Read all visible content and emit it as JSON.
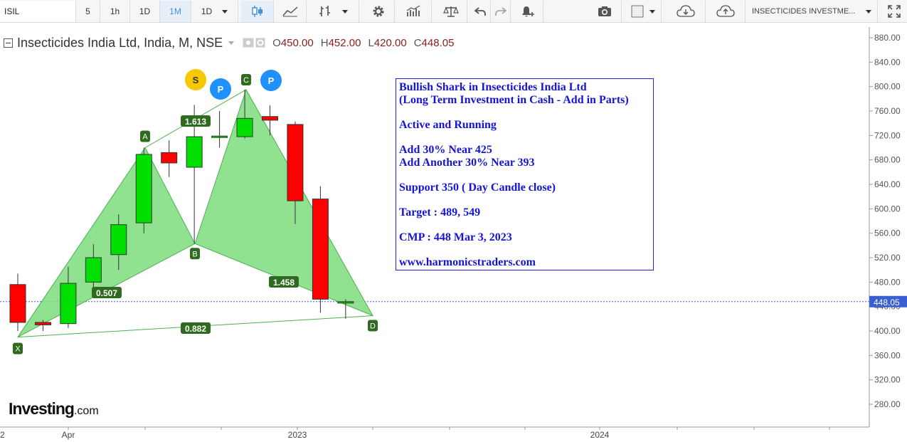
{
  "toolbar": {
    "symbol": "ISIL",
    "intervals": [
      "5",
      "1h",
      "1D",
      "1M",
      "1D"
    ],
    "active_interval": "1M",
    "instrument": "INSECTICIDES INVESTME..."
  },
  "header": {
    "title": "Insecticides India Ltd, India, M, NSE",
    "open_label": "O",
    "open": "450.00",
    "high_label": "H",
    "high": "452.00",
    "low_label": "L",
    "low": "420.00",
    "close_label": "C",
    "close": "448.05"
  },
  "annotation": {
    "line1": "Bullish Shark in Insecticides India Ltd",
    "line2": "(Long Term Investment in Cash - Add in Parts)",
    "line3": "Active and Running",
    "line4": "Add 30% Near 425",
    "line5": "Add Another 30% Near 393",
    "line6": "Support 350 ( Day Candle close)",
    "line7": "Target : 489, 549",
    "line8": "CMP : 448 Mar 3, 2023",
    "line9": "www.harmonicstraders.com"
  },
  "logo": {
    "main": "Investing",
    "suffix": ".com"
  },
  "colors": {
    "up": "#00e000",
    "down": "#ff0000",
    "pattern_fill": "#7ddc7d",
    "price_line": "#3a5fd0",
    "label_bg": "#2e6b1f"
  },
  "chart_data": {
    "type": "candlestick",
    "candles": [
      {
        "o": 476,
        "h": 494,
        "l": 400,
        "c": 414
      },
      {
        "o": 414,
        "h": 418,
        "l": 400,
        "c": 410
      },
      {
        "o": 412,
        "h": 505,
        "l": 405,
        "c": 478
      },
      {
        "o": 480,
        "h": 542,
        "l": 465,
        "c": 520
      },
      {
        "o": 525,
        "h": 591,
        "l": 500,
        "c": 574
      },
      {
        "o": 577,
        "h": 700,
        "l": 560,
        "c": 689
      },
      {
        "o": 692,
        "h": 712,
        "l": 652,
        "c": 675
      },
      {
        "o": 668,
        "h": 770,
        "l": 543,
        "c": 718
      },
      {
        "o": 718,
        "h": 760,
        "l": 700,
        "c": 719
      },
      {
        "o": 718,
        "h": 795,
        "l": 715,
        "c": 748
      },
      {
        "o": 751,
        "h": 769,
        "l": 720,
        "c": 745
      },
      {
        "o": 738,
        "h": 743,
        "l": 575,
        "c": 613
      },
      {
        "o": 616,
        "h": 637,
        "l": 430,
        "c": 452
      },
      {
        "o": 448,
        "h": 452,
        "l": 420,
        "c": 448
      }
    ],
    "pattern": {
      "points": [
        {
          "label": "X",
          "price": 390
        },
        {
          "label": "A",
          "price": 700
        },
        {
          "label": "B",
          "price": 543
        },
        {
          "label": "C",
          "price": 795
        },
        {
          "label": "D",
          "price": 425
        }
      ],
      "ratios": [
        "0.507",
        "1.613",
        "1.458",
        "0.882"
      ]
    },
    "markers": [
      "S",
      "P",
      "P"
    ],
    "y_ticks": [
      "880.00",
      "840.00",
      "800.00",
      "760.00",
      "720.00",
      "680.00",
      "640.00",
      "600.00",
      "560.00",
      "520.00",
      "480.00",
      "440.00",
      "400.00",
      "360.00",
      "320.00",
      "280.00"
    ],
    "ylim": [
      250,
      900
    ],
    "x_ticks": [
      "2",
      "Apr",
      "2023",
      "2024"
    ],
    "last_price": "448.05"
  }
}
